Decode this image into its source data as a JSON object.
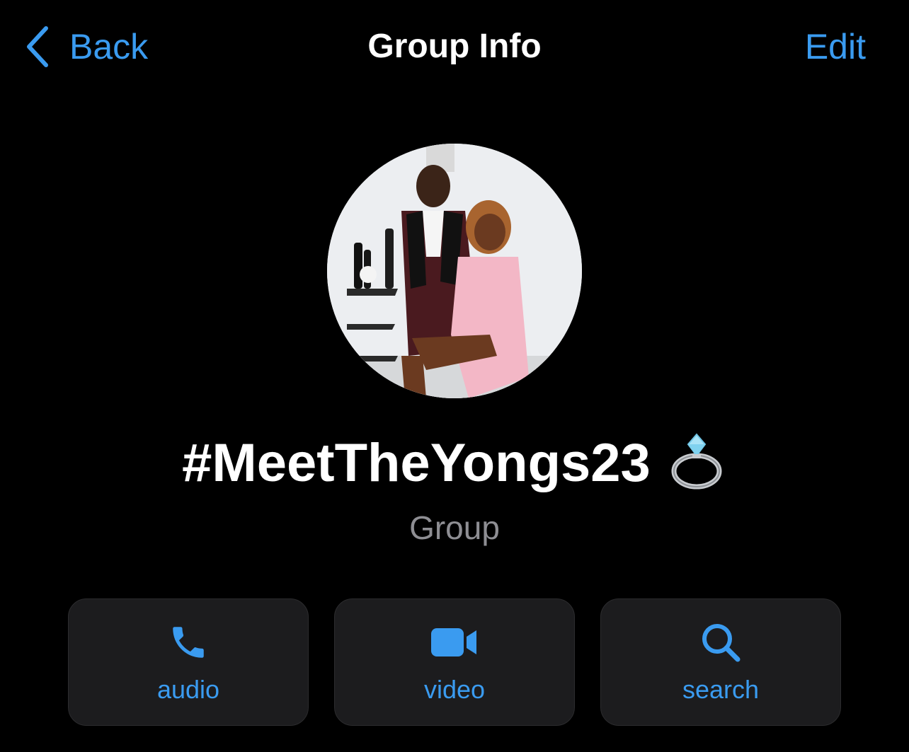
{
  "nav": {
    "back_label": "Back",
    "title": "Group Info",
    "edit_label": "Edit"
  },
  "group": {
    "name": "#MeetTheYongs23",
    "name_emoji_icon": "ring-icon",
    "subtitle": "Group"
  },
  "actions": [
    {
      "label": "audio",
      "icon": "phone-icon"
    },
    {
      "label": "video",
      "icon": "video-camera-icon"
    },
    {
      "label": "search",
      "icon": "search-icon"
    }
  ],
  "colors": {
    "accent": "#3a9bf0",
    "background": "#000000",
    "card": "#1c1c1e",
    "secondary_text": "#8e8e93"
  }
}
